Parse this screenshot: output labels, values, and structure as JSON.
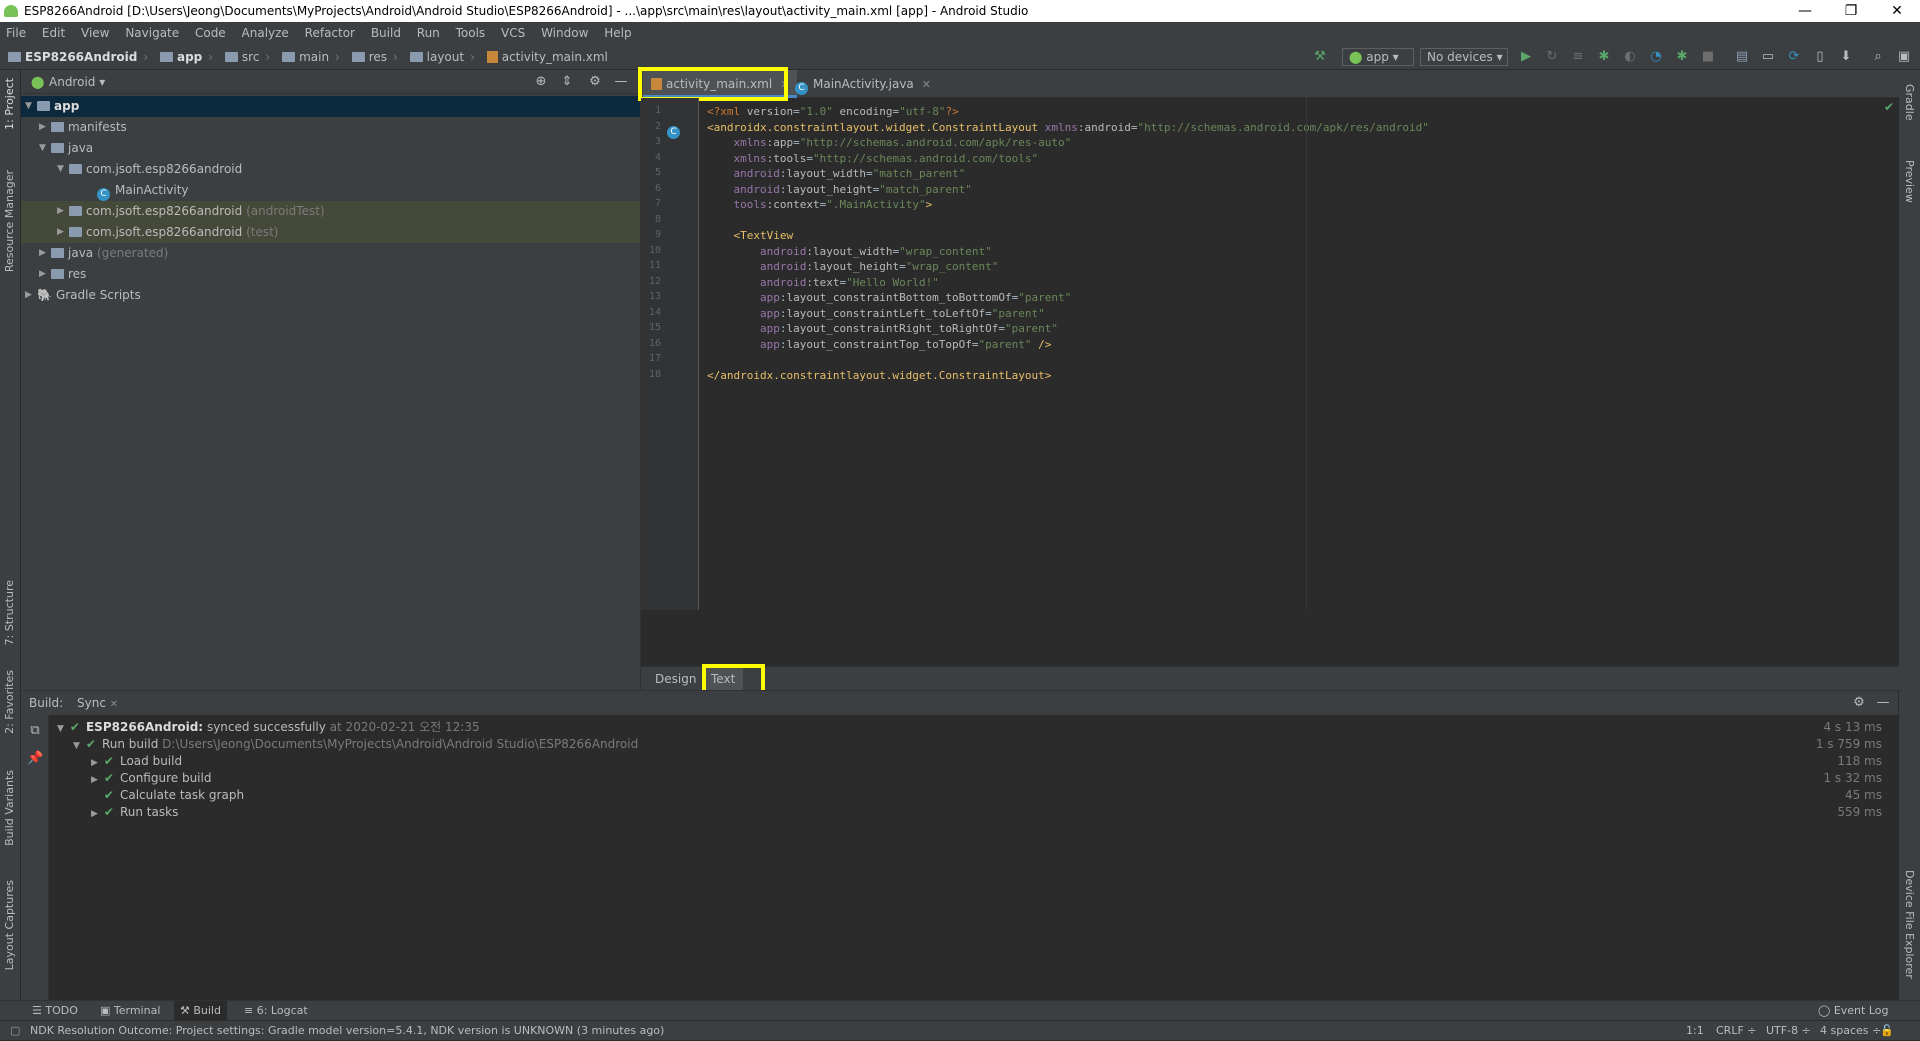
{
  "window": {
    "title": "ESP8266Android [D:\\Users\\Jeong\\Documents\\MyProjects\\Android\\Android Studio\\ESP8266Android] - ...\\app\\src\\main\\res\\layout\\activity_main.xml [app] - Android Studio",
    "minimize": "—",
    "restore": "❐",
    "close": "✕"
  },
  "menu": [
    "File",
    "Edit",
    "View",
    "Navigate",
    "Code",
    "Analyze",
    "Refactor",
    "Build",
    "Run",
    "Tools",
    "VCS",
    "Window",
    "Help"
  ],
  "breadcrumb": [
    "ESP8266Android",
    "app",
    "src",
    "main",
    "res",
    "layout",
    "activity_main.xml"
  ],
  "toolbar": {
    "config": "app",
    "device": "No devices"
  },
  "left_tabs": [
    "1: Project",
    "Resource Manager",
    "7: Structure",
    "2: Favorites",
    "Build Variants",
    "Layout Captures"
  ],
  "right_tabs": [
    "Gradle",
    "Preview",
    "Device File Explorer"
  ],
  "project": {
    "view": "Android",
    "tree": {
      "app": "app",
      "manifests": "manifests",
      "java": "java",
      "pkg_main": "com.jsoft.esp8266android",
      "main_activity": "MainActivity",
      "pkg_android_test": "com.jsoft.esp8266android",
      "android_test_suffix": "(androidTest)",
      "pkg_test": "com.jsoft.esp8266android",
      "test_suffix": "(test)",
      "java_generated": "java",
      "generated_suffix": "(generated)",
      "res": "res",
      "gradle": "Gradle Scripts"
    }
  },
  "editor": {
    "tabs": [
      {
        "label": "activity_main.xml"
      },
      {
        "label": "MainActivity.java"
      }
    ],
    "design_tab": "Design",
    "text_tab": "Text",
    "highlight_color": "#ffff00",
    "lines": [
      "<?xml version=\"1.0\" encoding=\"utf-8\"?>",
      "<androidx.constraintlayout.widget.ConstraintLayout xmlns:android=\"http://schemas.android.com/apk/res/android\"",
      "    xmlns:app=\"http://schemas.android.com/apk/res-auto\"",
      "    xmlns:tools=\"http://schemas.android.com/tools\"",
      "    android:layout_width=\"match_parent\"",
      "    android:layout_height=\"match_parent\"",
      "    tools:context=\".MainActivity\">",
      "",
      "    <TextView",
      "        android:layout_width=\"wrap_content\"",
      "        android:layout_height=\"wrap_content\"",
      "        android:text=\"Hello World!\"",
      "        app:layout_constraintBottom_toBottomOf=\"parent\"",
      "        app:layout_constraintLeft_toLeftOf=\"parent\"",
      "        app:layout_constraintRight_toRightOf=\"parent\"",
      "        app:layout_constraintTop_toTopOf=\"parent\" />",
      "",
      "</androidx.constraintlayout.widget.ConstraintLayout>"
    ]
  },
  "build": {
    "label": "Build:",
    "tab": "Sync",
    "rows": [
      {
        "title": "ESP8266Android:",
        "detail": "synced successfully",
        "extra": "at 2020-02-21 오전 12:35",
        "time": "4 s 13 ms"
      },
      {
        "title": "Run build",
        "detail": "D:\\Users\\Jeong\\Documents\\MyProjects\\Android\\Android Studio\\ESP8266Android",
        "time": "1 s 759 ms"
      },
      {
        "title": "Load build",
        "time": "118 ms"
      },
      {
        "title": "Configure build",
        "time": "1 s 32 ms"
      },
      {
        "title": "Calculate task graph",
        "time": "45 ms"
      },
      {
        "title": "Run tasks",
        "time": "559 ms"
      }
    ]
  },
  "bottom_tabs": {
    "todo": "TODO",
    "terminal": "Terminal",
    "build": "Build",
    "logcat": "6: Logcat",
    "event_log": "Event Log"
  },
  "status": {
    "message": "NDK Resolution Outcome: Project settings: Gradle model version=5.4.1, NDK version is UNKNOWN (3 minutes ago)",
    "position": "1:1",
    "line_sep": "CRLF ÷",
    "encoding": "UTF-8 ÷",
    "indent": "4 spaces ÷"
  }
}
